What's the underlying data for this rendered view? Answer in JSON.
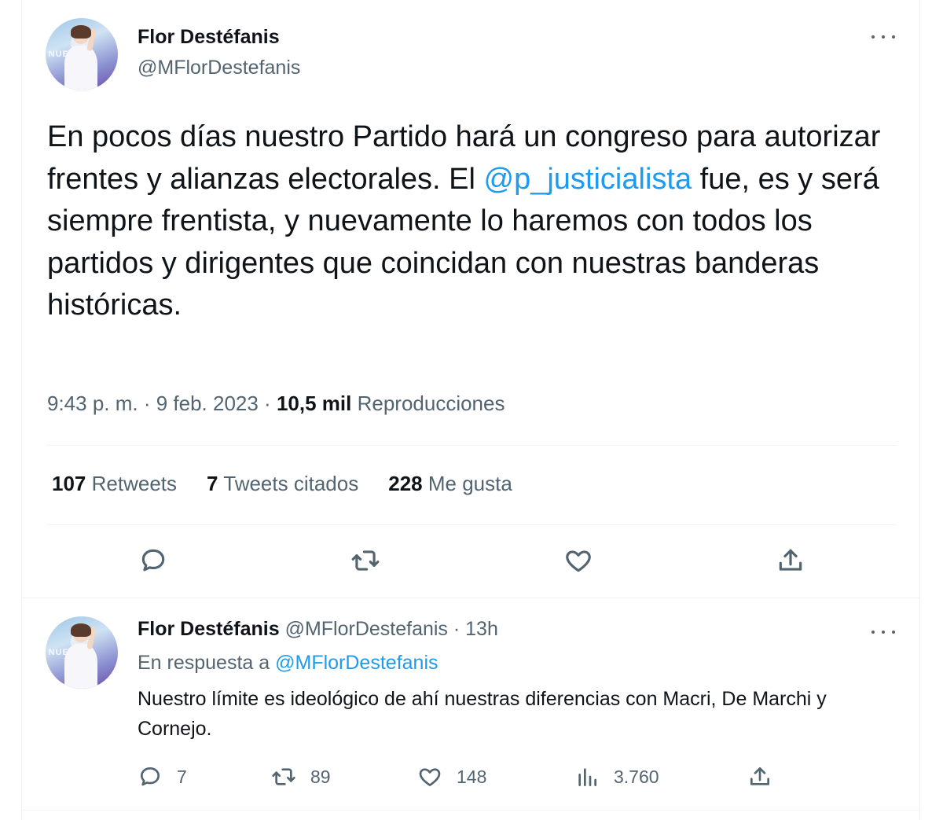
{
  "main_tweet": {
    "author_name": "Flor Destéfanis",
    "author_handle": "@MFlorDestefanis",
    "text_before_mention": "En pocos días nuestro Partido hará un congreso para autorizar frentes y alianzas electorales. El ",
    "mention": "@p_justicialista",
    "text_after_mention": " fue, es y será siempre frentista, y nuevamente lo haremos con todos los partidos y dirigentes que coincidan con nuestras banderas históricas.",
    "timestamp": "9:43 p. m. · 9 feb. 2023 · ",
    "views_count": "10,5 mil",
    "views_label": " Reproducciones",
    "stats": {
      "retweets_count": "107",
      "retweets_label": "Retweets",
      "quotes_count": "7",
      "quotes_label": "Tweets citados",
      "likes_count": "228",
      "likes_label": "Me gusta"
    }
  },
  "reply_tweet": {
    "author_name": "Flor Destéfanis",
    "author_handle": "@MFlorDestefanis",
    "time_ago": " · 13h",
    "reply_prefix": "En respuesta a ",
    "reply_to": "@MFlorDestefanis",
    "text": "Nuestro límite es ideológico de ahí nuestras diferencias con Macri, De Marchi y Cornejo.",
    "counts": {
      "replies": "7",
      "retweets": "89",
      "likes": "148",
      "views": "3.760"
    }
  },
  "icons": [
    "reply-icon",
    "retweet-icon",
    "like-icon",
    "share-icon",
    "views-icon",
    "more-icon"
  ],
  "colors": {
    "accent": "#1d9bf0",
    "text": "#0f1419",
    "muted": "#536471",
    "border": "#eff3f4"
  }
}
